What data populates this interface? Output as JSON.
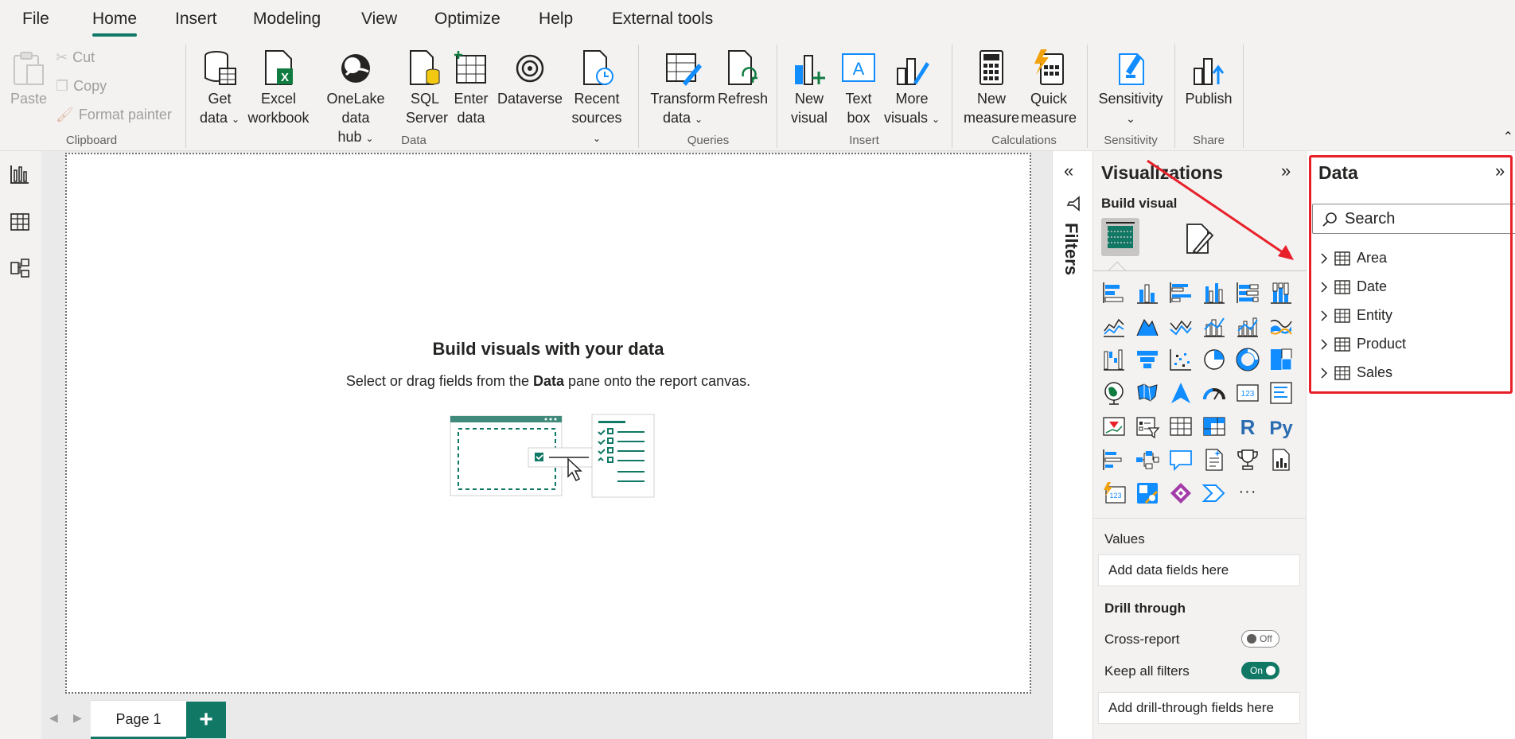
{
  "menu": {
    "tabs": [
      {
        "label": "File",
        "active": false
      },
      {
        "label": "Home",
        "active": true
      },
      {
        "label": "Insert",
        "active": false
      },
      {
        "label": "Modeling",
        "active": false
      },
      {
        "label": "View",
        "active": false
      },
      {
        "label": "Optimize",
        "active": false
      },
      {
        "label": "Help",
        "active": false
      },
      {
        "label": "External tools",
        "active": false
      }
    ]
  },
  "ribbon": {
    "clipboard": {
      "paste": "Paste",
      "cut": "Cut",
      "copy": "Copy",
      "format_painter": "Format painter",
      "group": "Clipboard"
    },
    "data": {
      "get_data_1": "Get",
      "get_data_2": "data",
      "excel_1": "Excel",
      "excel_2": "workbook",
      "onelake_1": "OneLake data",
      "onelake_2": "hub",
      "sql_1": "SQL",
      "sql_2": "Server",
      "enter_1": "Enter",
      "enter_2": "data",
      "dataverse": "Dataverse",
      "recent_1": "Recent",
      "recent_2": "sources",
      "group": "Data"
    },
    "queries": {
      "transform_1": "Transform",
      "transform_2": "data",
      "refresh": "Refresh",
      "group": "Queries"
    },
    "insert": {
      "new_visual_1": "New",
      "new_visual_2": "visual",
      "text_box_1": "Text",
      "text_box_2": "box",
      "more_visuals_1": "More",
      "more_visuals_2": "visuals",
      "group": "Insert"
    },
    "calculations": {
      "new_measure_1": "New",
      "new_measure_2": "measure",
      "quick_measure_1": "Quick",
      "quick_measure_2": "measure",
      "group": "Calculations"
    },
    "sensitivity": {
      "label": "Sensitivity",
      "group": "Sensitivity"
    },
    "share": {
      "publish": "Publish",
      "group": "Share"
    }
  },
  "canvas": {
    "empty_title": "Build visuals with your data",
    "empty_sub_pre": "Select or drag fields from the ",
    "empty_sub_bold": "Data",
    "empty_sub_post": " pane onto the report canvas."
  },
  "pages": {
    "tabs": [
      "Page 1"
    ],
    "add": "+"
  },
  "filters": {
    "label": "Filters"
  },
  "visualizations": {
    "title": "Visualizations",
    "build_visual": "Build visual",
    "more": "···",
    "values_label": "Values",
    "values_placeholder": "Add data fields here",
    "drill_through": "Drill through",
    "cross_report": "Cross-report",
    "cross_report_state": "Off",
    "keep_filters": "Keep all filters",
    "keep_filters_state": "On",
    "drill_placeholder": "Add drill-through fields here",
    "r_label": "R",
    "py_label": "Py"
  },
  "data_pane": {
    "title": "Data",
    "search_placeholder": "Search",
    "tables": [
      "Area",
      "Date",
      "Entity",
      "Product",
      "Sales"
    ]
  },
  "colors": {
    "accent": "#117865",
    "annotation": "#e8202a",
    "icon_blue": "#118dff"
  }
}
